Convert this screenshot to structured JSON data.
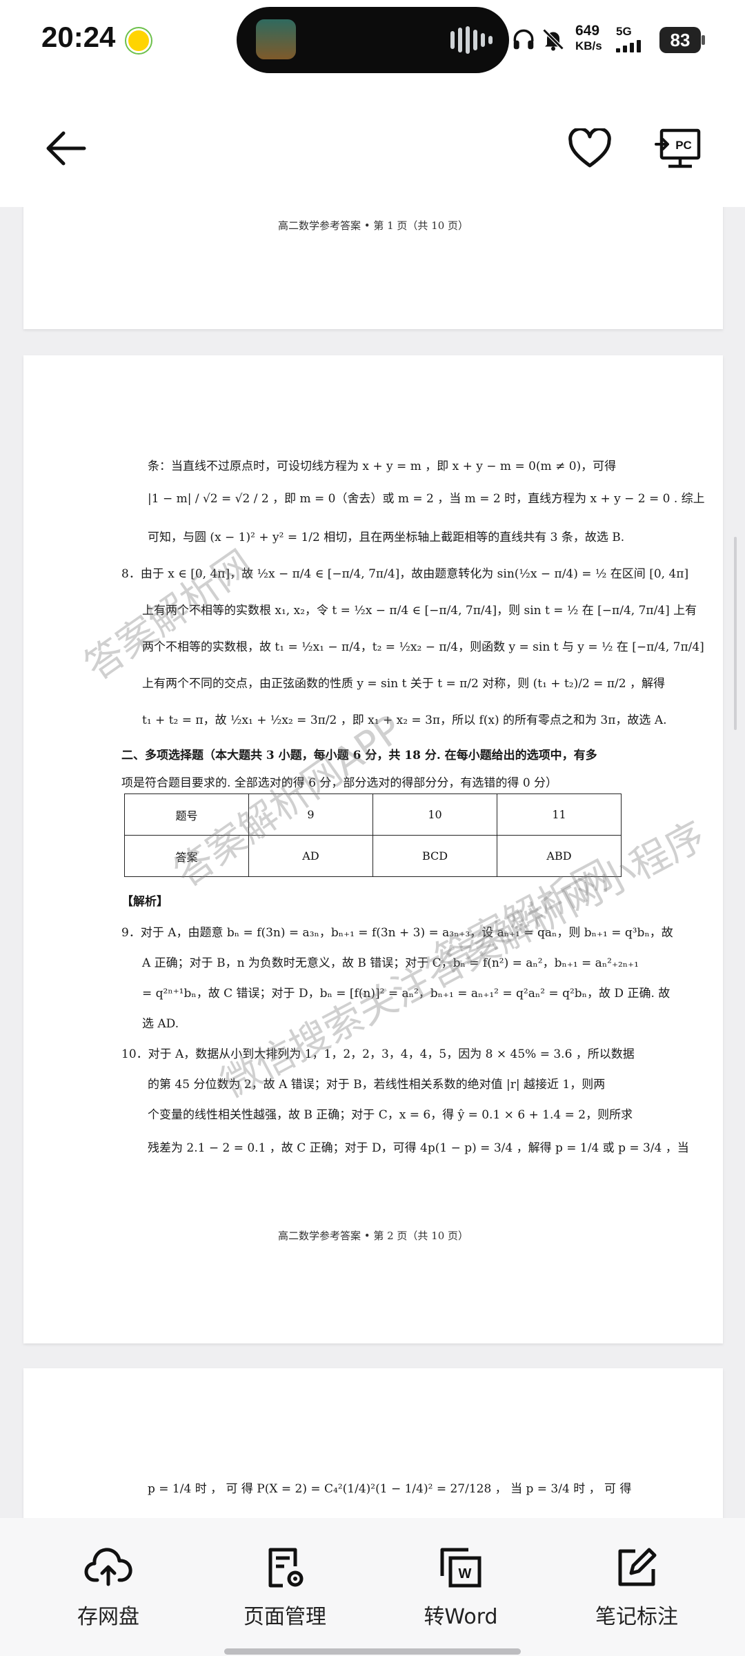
{
  "status_bar": {
    "time": "20:24",
    "net_speed_value": "649",
    "net_speed_unit": "KB/s",
    "network": "5G",
    "battery": "83"
  },
  "toolbar": {
    "back_icon": "arrow-left-icon",
    "favorite_icon": "heart-icon",
    "pc_icon": "send-to-pc-icon",
    "pc_label": "PC"
  },
  "document": {
    "page1_footer": "高二数学参考答案 • 第 1 页（共 10 页）",
    "page2_footer": "高二数学参考答案 • 第 2 页（共 10 页）",
    "page2_lines": [
      "条：当直线不过原点时，可设切线方程为 x + y = m ，即 x + y − m = 0(m ≠ 0)，可得",
      "|1 − m| / √2 = √2 / 2 ，即 m = 0（舍去）或 m = 2 ，当 m = 2 时，直线方程为 x + y − 2 = 0 . 综上",
      "可知，与圆 (x − 1)² + y² = 1/2 相切，且在两坐标轴上截距相等的直线共有 3 条，故选 B.",
      "8．由于 x ∈ [0, 4π]，故 ½x − π/4 ∈ [−π/4, 7π/4]，故由题意转化为 sin(½x − π/4) = ½ 在区间 [0, 4π]",
      "上有两个不相等的实数根 x₁, x₂，令 t = ½x − π/4 ∈ [−π/4, 7π/4]，则 sin t = ½ 在 [−π/4, 7π/4] 上有",
      "两个不相等的实数根，故 t₁ = ½x₁ − π/4，t₂ = ½x₂ − π/4，则函数 y = sin t 与 y = ½ 在 [−π/4, 7π/4]",
      "上有两个不同的交点，由正弦函数的性质 y = sin t 关于 t = π/2 对称，则 (t₁ + t₂)/2 = π/2 ，解得",
      "t₁ + t₂ = π，故 ½x₁ + ½x₂ = 3π/2 ，即 x₁ + x₂ = 3π，所以 f(x) 的所有零点之和为 3π，故选 A.",
      "二、多项选择题（本大题共 3 小题，每小题 6 分，共 18 分. 在每小题给出的选项中，有多",
      "项是符合题目要求的. 全部选对的得 6 分，部分选对的得部分分，有选错的得 0 分）"
    ],
    "table": {
      "header": [
        "题号",
        "9",
        "10",
        "11"
      ],
      "row": [
        "答案",
        "AD",
        "BCD",
        "ABD"
      ]
    },
    "analysis_title": "【解析】",
    "analysis_lines": [
      "9．对于 A，由题意 bₙ = f(3n) = a₃ₙ，bₙ₊₁ = f(3n + 3) = a₃ₙ₊₃，设 aₙ₊₁ = qaₙ，则 bₙ₊₁ = q³bₙ，故",
      "A 正确；对于 B，n 为负数时无意义，故 B 错误；对于 C，bₙ = f(n²) = aₙ²，bₙ₊₁ = aₙ²₊₂ₙ₊₁",
      "= q²ⁿ⁺¹bₙ，故 C 错误；对于 D，bₙ = [f(n)]² = aₙ²，bₙ₊₁ = aₙ₊₁² = q²aₙ² = q²bₙ，故 D 正确. 故",
      "选 AD.",
      "10．对于 A，数据从小到大排列为 1，1，2，2，3，4，4，5，因为 8 × 45% = 3.6 ，所以数据",
      "的第 45 分位数为 2，故 A 错误；对于 B，若线性相关系数的绝对值 |r| 越接近 1，则两",
      "个变量的线性相关性越强，故 B 正确；对于 C，x = 6，得 ŷ = 0.1 × 6 + 1.4 = 2，则所求",
      "残差为 2.1 − 2 = 0.1 ，故 C 正确；对于 D，可得 4p(1 − p) = 3/4 ，解得 p = 1/4 或 p = 3/4 ，当"
    ],
    "page3_line": "p = 1/4  时 ，  可 得   P(X = 2) = C₄²(1/4)²(1 − 1/4)² = 27/128  ，  当  p = 3/4  时 ，  可 得",
    "watermarks": [
      "答案解析网",
      "答案解析网APP",
      "微信搜索关注答案解析网小程序",
      "答案解析网"
    ]
  },
  "bottom_bar": {
    "items": [
      {
        "label": "存网盘",
        "icon": "cloud-upload-icon"
      },
      {
        "label": "页面管理",
        "icon": "page-settings-icon"
      },
      {
        "label": "转Word",
        "icon": "convert-word-icon"
      },
      {
        "label": "笔记标注",
        "icon": "edit-note-icon"
      }
    ]
  }
}
